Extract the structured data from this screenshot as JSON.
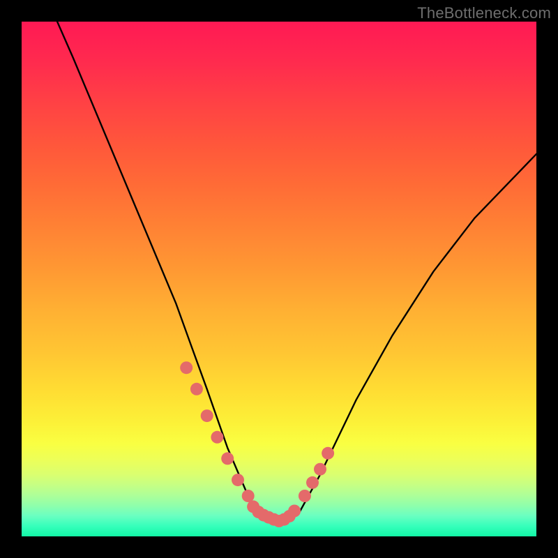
{
  "watermark": "TheBottleneck.com",
  "chart_data": {
    "type": "line",
    "title": "",
    "xlabel": "",
    "ylabel": "",
    "xlim": [
      0,
      100
    ],
    "ylim": [
      0,
      100
    ],
    "series": [
      {
        "name": "curve",
        "x": [
          0,
          10,
          20,
          30,
          33,
          36,
          40,
          44,
          47,
          50,
          54,
          58,
          65,
          72,
          80,
          88,
          96,
          100
        ],
        "y": [
          110,
          88,
          65,
          42,
          34,
          26,
          15,
          6,
          2,
          0.6,
          3,
          10,
          24,
          36,
          48,
          58,
          66,
          70
        ]
      }
    ],
    "highlights": {
      "name": "pink-dots",
      "x": [
        32,
        34,
        36,
        38,
        40,
        42,
        44,
        45,
        46,
        47,
        48,
        49,
        50,
        51,
        52,
        53,
        55,
        56.5,
        58,
        59.5
      ],
      "y": [
        30,
        26,
        21,
        17,
        13,
        9,
        6,
        4,
        3,
        2.4,
        2,
        1.6,
        1.3,
        1.6,
        2.2,
        3.2,
        6,
        8.5,
        11,
        14
      ]
    },
    "colors": {
      "curve": "#000000",
      "dots": "#e46a6a",
      "gradient_top": "#ff1954",
      "gradient_bottom": "#12f7a6",
      "background_border": "#000000"
    }
  }
}
